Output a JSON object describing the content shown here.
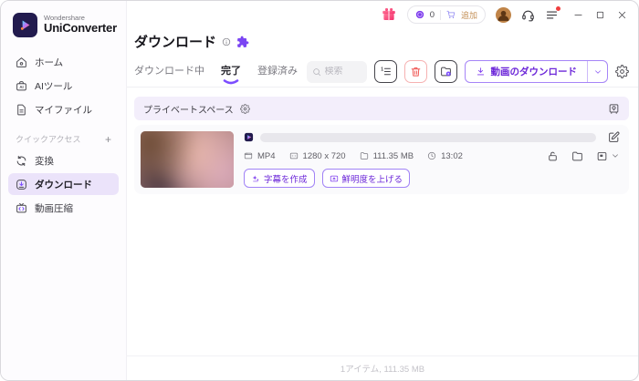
{
  "brand": {
    "company": "Wondershare",
    "product": "UniConverter"
  },
  "titlebar": {
    "points": "0",
    "cart_label": "追加",
    "icons": [
      "gift-icon",
      "coin-icon",
      "cart-icon",
      "avatar",
      "headset-icon",
      "menu-icon",
      "minimize-icon",
      "maximize-icon",
      "close-icon"
    ]
  },
  "sidebar": {
    "items": [
      {
        "label": "ホーム",
        "icon": "home-icon"
      },
      {
        "label": "AIツール",
        "icon": "ai-tools-icon"
      },
      {
        "label": "マイファイル",
        "icon": "my-files-icon"
      }
    ],
    "quick_access": {
      "section_label": "クイックアクセス",
      "add_label": "+",
      "items": [
        {
          "label": "変換",
          "icon": "convert-icon",
          "active": false
        },
        {
          "label": "ダウンロード",
          "icon": "download-nav-icon",
          "active": true
        },
        {
          "label": "動画圧縮",
          "icon": "video-compress-icon",
          "active": false
        }
      ]
    }
  },
  "page": {
    "title": "ダウンロード",
    "title_icons": [
      "info-icon",
      "puzzle-icon"
    ]
  },
  "tabs": [
    {
      "label": "ダウンロード中",
      "active": false
    },
    {
      "label": "完了",
      "active": true
    },
    {
      "label": "登録済み",
      "active": false
    }
  ],
  "toolbar": {
    "search_placeholder": "検索",
    "download_button_label": "動画のダウンロード",
    "icon_buttons": [
      "numbered-list-icon",
      "trash-icon",
      "folder-badge-icon",
      "gear-icon"
    ]
  },
  "private_space": {
    "label": "プライベートスペース",
    "icons": [
      "gear-icon",
      "safe-icon"
    ]
  },
  "file": {
    "format": "MP4",
    "resolution": "1280 x 720",
    "size": "111.35 MB",
    "duration": "13:02",
    "row_icons": [
      "lock-icon",
      "folder-icon",
      "snapshot-icon"
    ],
    "action_buttons": [
      {
        "label": "字幕を作成",
        "icon": "ai-subtitle-icon"
      },
      {
        "label": "鮮明度を上げる",
        "icon": "enhance-icon"
      }
    ]
  },
  "statusbar": {
    "summary": "1アイテム, 111.35 MB"
  },
  "colors": {
    "accent": "#7c3aed",
    "accent_border": "#a685f7",
    "selected_bg": "#ebe3fa",
    "space_bg": "#f3eefb",
    "card_bg": "#fafafc",
    "danger": "#ef5350",
    "gift_pink": "#f42d6b"
  }
}
